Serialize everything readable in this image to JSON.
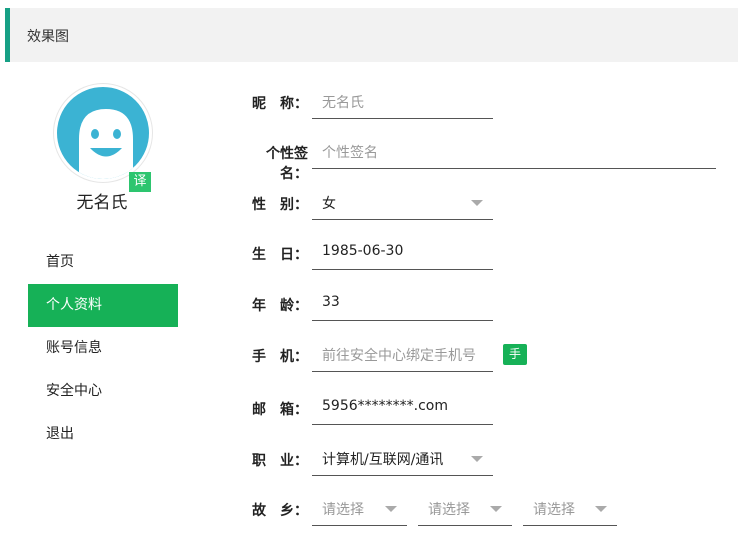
{
  "header": {
    "title": "效果图"
  },
  "profile": {
    "name": "无名氏",
    "translate_badge": "译",
    "avatar_color": "#3bb3d3"
  },
  "menu": {
    "items": [
      {
        "label": "首页",
        "active": false
      },
      {
        "label": "个人资料",
        "active": true
      },
      {
        "label": "账号信息",
        "active": false
      },
      {
        "label": "安全中心",
        "active": false
      },
      {
        "label": "退出",
        "active": false
      }
    ]
  },
  "form": {
    "nickname": {
      "label": "昵　称：",
      "placeholder": "无名氏"
    },
    "signature": {
      "label": "个性签名：",
      "placeholder": "个性签名"
    },
    "gender": {
      "label": "性　别：",
      "value": "女"
    },
    "birthday": {
      "label": "生　日：",
      "value": "1985-06-30"
    },
    "age": {
      "label": "年　龄：",
      "value": "33"
    },
    "phone": {
      "label": "手　机：",
      "placeholder": "前往安全中心绑定手机号",
      "verify_button": "手机验证"
    },
    "email": {
      "label": "邮　箱：",
      "value": "5956********.com"
    },
    "occupation": {
      "label": "职　业：",
      "value": "计算机/互联网/通讯"
    },
    "hometown": {
      "label": "故　乡：",
      "province": "请选择",
      "city": "请选择",
      "district": "请选择"
    }
  },
  "colors": {
    "accent": "#16b157",
    "header_border": "#16a085"
  }
}
